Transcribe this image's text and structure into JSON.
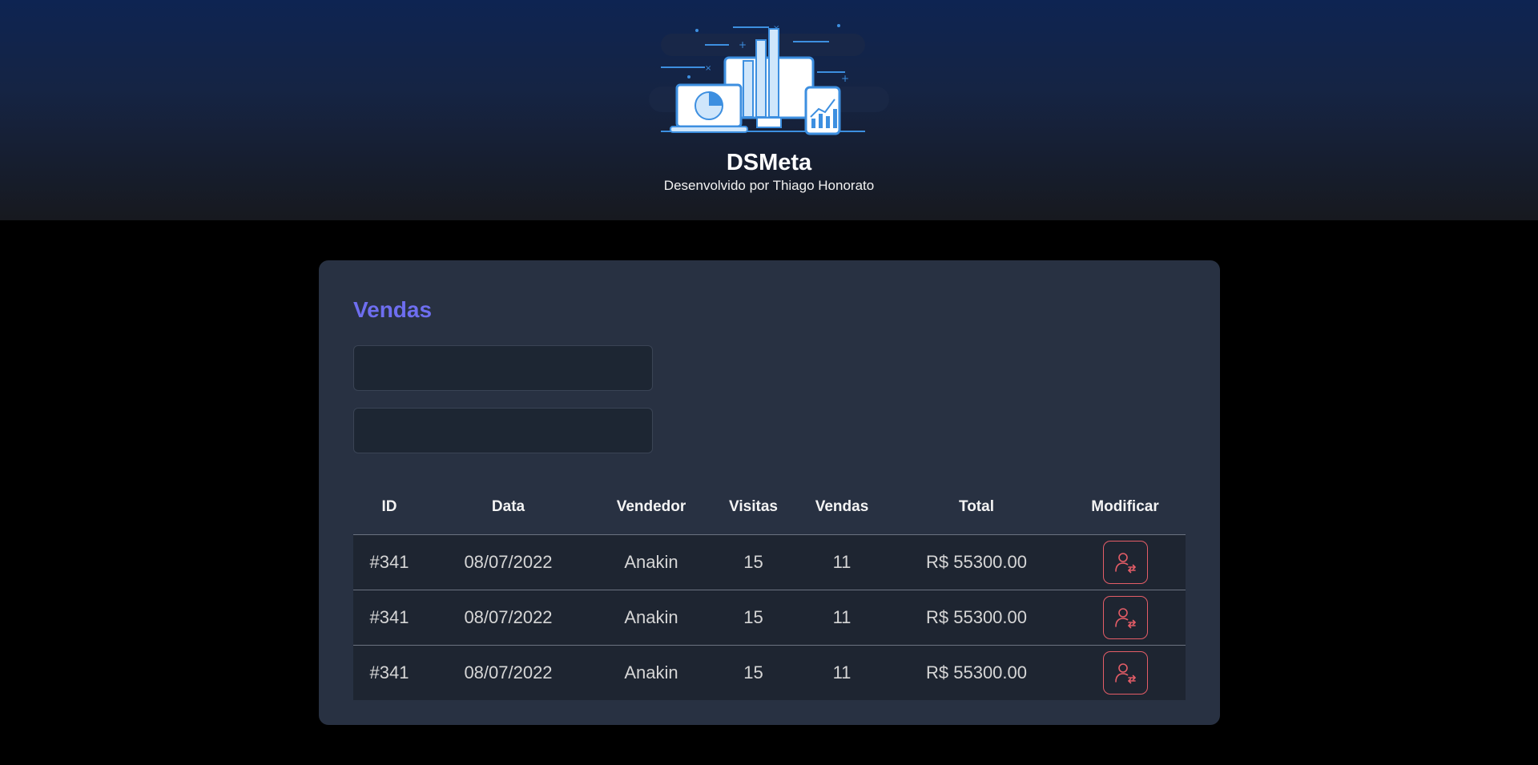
{
  "header": {
    "title": "DSMeta",
    "subtitle": "Desenvolvido por Thiago Honorato"
  },
  "card": {
    "title": "Vendas",
    "min_date_value": "",
    "max_date_value": ""
  },
  "table": {
    "headers": [
      "ID",
      "Data",
      "Vendedor",
      "Visitas",
      "Vendas",
      "Total",
      "Modificar"
    ],
    "rows": [
      {
        "id": "#341",
        "date": "08/07/2022",
        "seller": "Anakin",
        "visits": "15",
        "deals": "11",
        "total": "R$ 55300.00"
      },
      {
        "id": "#341",
        "date": "08/07/2022",
        "seller": "Anakin",
        "visits": "15",
        "deals": "11",
        "total": "R$ 55300.00"
      },
      {
        "id": "#341",
        "date": "08/07/2022",
        "seller": "Anakin",
        "visits": "15",
        "deals": "11",
        "total": "R$ 55300.00"
      }
    ]
  },
  "icons": {
    "logo": "analytics-devices-illustration",
    "notify": "user-notify-icon"
  },
  "colors": {
    "accent": "#6e6ef0",
    "card_bg": "#283142",
    "notify_red": "#e45d67",
    "header_top": "#0e2452",
    "header_bottom": "#17191f"
  }
}
